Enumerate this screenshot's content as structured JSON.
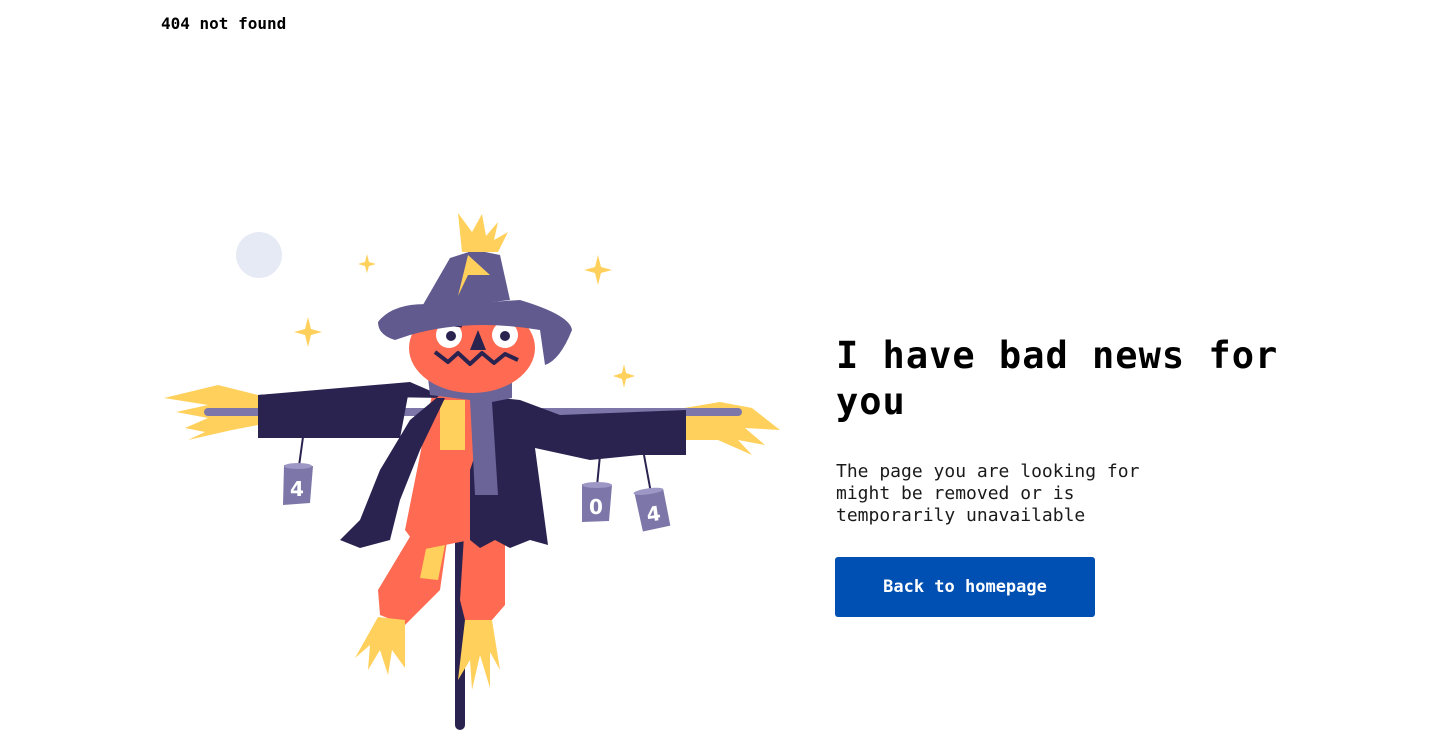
{
  "header": {
    "status_label": "404 not found"
  },
  "main": {
    "headline": "I have bad news for you",
    "description": "The page you are looking for might be removed or is temporarily unavailable",
    "button_label": "Back to homepage"
  },
  "illustration": {
    "cans": [
      "4",
      "0",
      "4"
    ],
    "colors": {
      "coat": "#2a2350",
      "hat": "#605a8f",
      "pumpkin": "#ff6b52",
      "straw": "#ffd15c",
      "scarf": "#6a6499",
      "moon": "#e6eaf5"
    }
  },
  "colors": {
    "button_bg": "#0050b3",
    "button_text": "#ffffff",
    "text": "#000000"
  }
}
